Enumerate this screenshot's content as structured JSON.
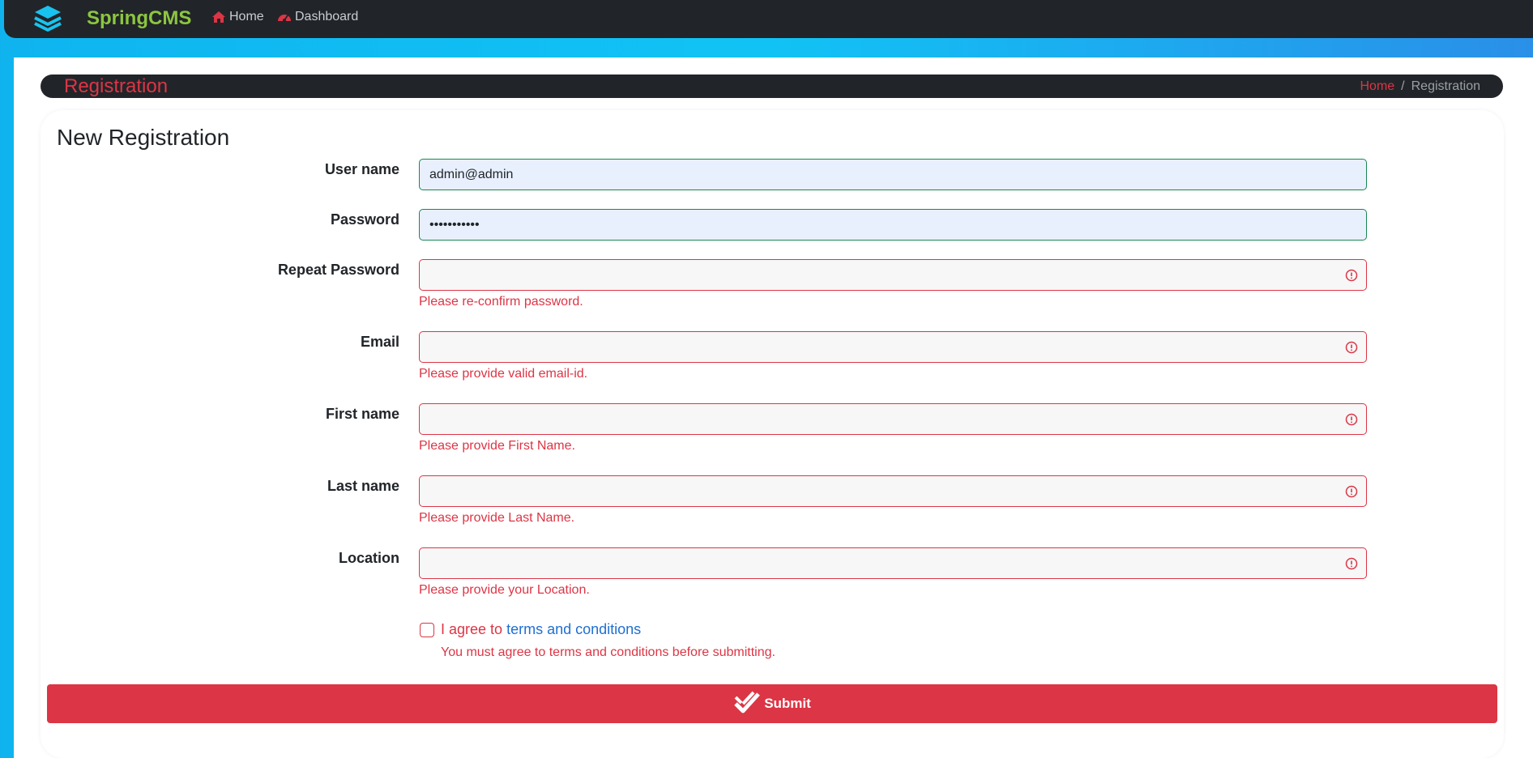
{
  "app": {
    "brand": "SpringCMS",
    "nav": [
      {
        "label": "Home",
        "icon": "home-icon"
      },
      {
        "label": "Dashboard",
        "icon": "dashboard-gauge-icon"
      }
    ]
  },
  "page_header": {
    "title": "Registration",
    "breadcrumb": {
      "home": "Home",
      "separator": "/",
      "current": "Registration"
    }
  },
  "form": {
    "title": "New Registration",
    "fields": [
      {
        "label": "User name",
        "value": "admin@admin",
        "state": "valid",
        "feedback": ""
      },
      {
        "label": "Password",
        "value": "•••••••••••",
        "state": "valid",
        "feedback": ""
      },
      {
        "label": "Repeat Password",
        "value": "",
        "state": "invalid",
        "feedback": "Please re-confirm password."
      },
      {
        "label": "Email",
        "value": "",
        "state": "invalid",
        "feedback": "Please provide valid email-id."
      },
      {
        "label": "First name",
        "value": "",
        "state": "invalid",
        "feedback": "Please provide First Name."
      },
      {
        "label": "Last name",
        "value": "",
        "state": "invalid",
        "feedback": "Please provide Last Name."
      },
      {
        "label": "Location",
        "value": "",
        "state": "invalid",
        "feedback": "Please provide your Location."
      }
    ],
    "terms": {
      "prefix": "I agree to ",
      "link": "terms and conditions",
      "checked": false,
      "feedback": "You must agree to terms and conditions before submitting."
    },
    "submit_label": "Submit"
  },
  "colors": {
    "navbar": "#212529",
    "brand": "#8cc63f",
    "danger": "#dc3545",
    "success": "#198754",
    "link": "#1f6fd1",
    "logo": "#19c3f0"
  }
}
